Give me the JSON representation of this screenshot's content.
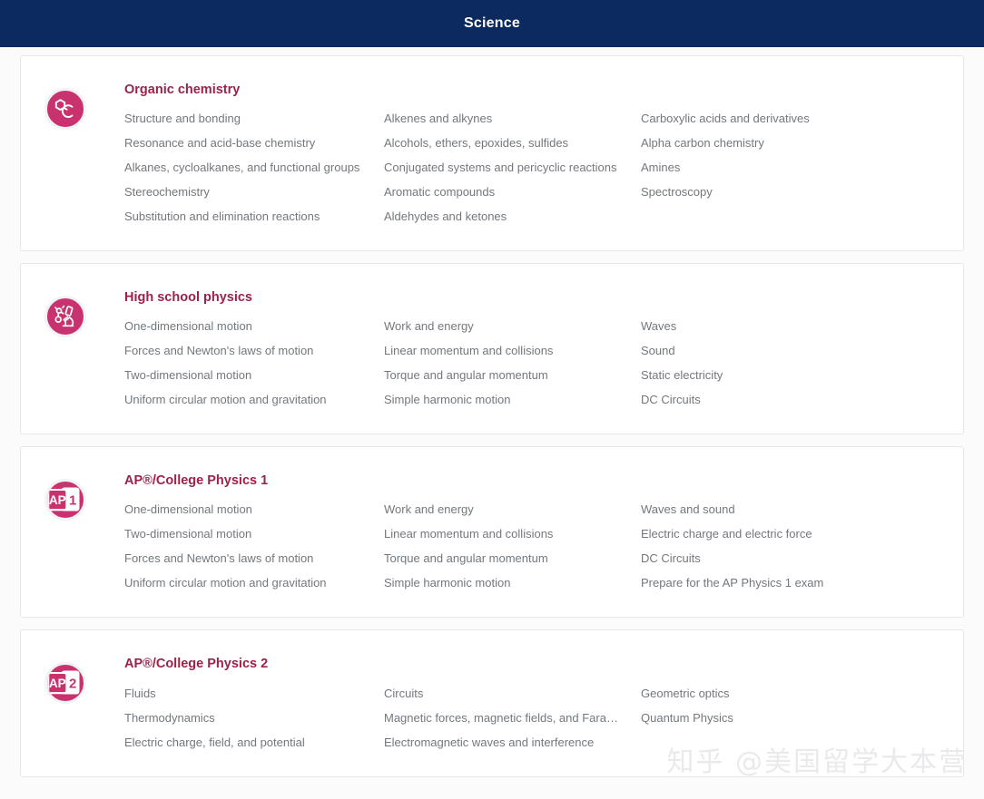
{
  "header": {
    "title": "Science"
  },
  "watermark": "知乎 @美国留学大本营",
  "colors": {
    "header_bg": "#0d2a5e",
    "icon_pink": "#c8336f",
    "title_maroon": "#9b2248",
    "link_gray": "#72787d",
    "card_border": "#e5e7e9",
    "page_bg": "#fbfbfc"
  },
  "cards": [
    {
      "id": "organic-chemistry",
      "title": "Organic chemistry",
      "icon": "hexagon-molecule-icon",
      "icon_label": "",
      "columns": [
        [
          "Structure and bonding",
          "Resonance and acid-base chemistry",
          "Alkanes, cycloalkanes, and functional groups",
          "Stereochemistry",
          "Substitution and elimination reactions"
        ],
        [
          "Alkenes and alkynes",
          "Alcohols, ethers, epoxides, sulfides",
          "Conjugated systems and pericyclic reactions",
          "Aromatic compounds",
          "Aldehydes and ketones"
        ],
        [
          "Carboxylic acids and derivatives",
          "Alpha carbon chemistry",
          "Amines",
          "Spectroscopy"
        ]
      ]
    },
    {
      "id": "high-school-physics",
      "title": "High school physics",
      "icon": "microscope-icon",
      "icon_label": "",
      "columns": [
        [
          "One-dimensional motion",
          "Forces and Newton's laws of motion",
          "Two-dimensional motion",
          "Uniform circular motion and gravitation"
        ],
        [
          "Work and energy",
          "Linear momentum and collisions",
          "Torque and angular momentum",
          "Simple harmonic motion"
        ],
        [
          "Waves",
          "Sound",
          "Static electricity",
          "DC Circuits"
        ]
      ]
    },
    {
      "id": "ap-college-physics-1",
      "title": "AP®/College Physics 1",
      "icon": "ap-exam-icon",
      "icon_label": "AP",
      "icon_number": "1",
      "columns": [
        [
          "One-dimensional motion",
          "Two-dimensional motion",
          "Forces and Newton's laws of motion",
          "Uniform circular motion and gravitation"
        ],
        [
          "Work and energy",
          "Linear momentum and collisions",
          "Torque and angular momentum",
          "Simple harmonic motion"
        ],
        [
          "Waves and sound",
          "Electric charge and electric force",
          "DC Circuits",
          "Prepare for the AP Physics 1 exam"
        ]
      ]
    },
    {
      "id": "ap-college-physics-2",
      "title": "AP®/College Physics 2",
      "icon": "ap-exam-icon",
      "icon_label": "AP",
      "icon_number": "2",
      "columns": [
        [
          "Fluids",
          "Thermodynamics",
          "Electric charge, field, and potential"
        ],
        [
          "Circuits",
          "Magnetic forces, magnetic fields, and Fara…",
          "Electromagnetic waves and interference"
        ],
        [
          "Geometric optics",
          "Quantum Physics"
        ]
      ]
    }
  ]
}
